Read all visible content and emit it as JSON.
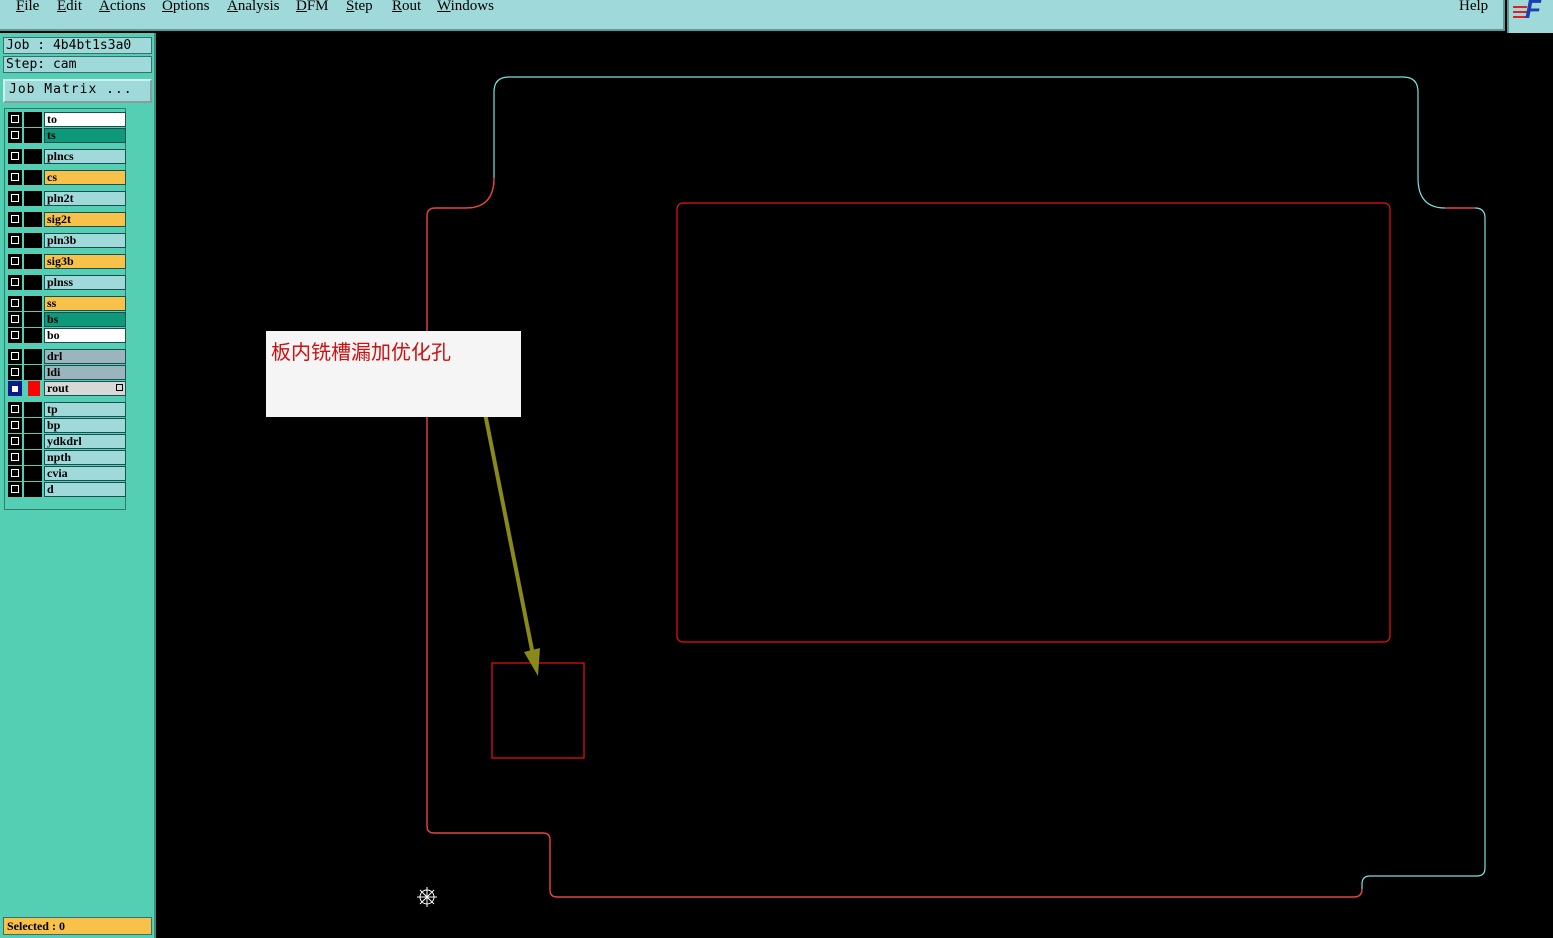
{
  "menu": {
    "items": [
      {
        "label": "File",
        "mnemonic": "F",
        "rest": "ile"
      },
      {
        "label": "Edit",
        "mnemonic": "E",
        "rest": "dit"
      },
      {
        "label": "Actions",
        "mnemonic": "A",
        "rest": "ctions"
      },
      {
        "label": "Options",
        "mnemonic": "O",
        "rest": "ptions"
      },
      {
        "label": "Analysis",
        "mnemonic": "A",
        "rest": "nalysis"
      },
      {
        "label": "DFM",
        "mnemonic": "D",
        "rest": "FM"
      },
      {
        "label": "Step",
        "mnemonic": "S",
        "rest": "tep"
      },
      {
        "label": "Rout",
        "mnemonic": "R",
        "rest": "out"
      },
      {
        "label": "Windows",
        "mnemonic": "W",
        "rest": "indows"
      }
    ],
    "help": {
      "label": "Help",
      "mnemonic": "H",
      "rest": "elp"
    }
  },
  "logo": {
    "text": "F",
    "icon": "frontline-logo-icon",
    "color": "#1a3fb0"
  },
  "job": {
    "label": "Job : 4b4bt1s3a0"
  },
  "step": {
    "label": "Step: cam"
  },
  "job_matrix_button": "Job Matrix ...",
  "layers": [
    {
      "name": "to",
      "color": "#ffffff",
      "active": false
    },
    {
      "name": "ts",
      "color": "#0e9a7a",
      "active": false
    },
    {
      "name": "plncs",
      "color": "#9fd9d9",
      "active": false
    },
    {
      "name": "cs",
      "color": "#f8c24a",
      "active": false
    },
    {
      "name": "pln2t",
      "color": "#9fd9d9",
      "active": false
    },
    {
      "name": "sig2t",
      "color": "#f8c24a",
      "active": false
    },
    {
      "name": "pln3b",
      "color": "#9fd9d9",
      "active": false
    },
    {
      "name": "sig3b",
      "color": "#f8c24a",
      "active": false
    },
    {
      "name": "plnss",
      "color": "#9fd9d9",
      "active": false
    },
    {
      "name": "ss",
      "color": "#f8c24a",
      "active": false
    },
    {
      "name": "bs",
      "color": "#0e9a7a",
      "active": false
    },
    {
      "name": "bo",
      "color": "#ffffff",
      "active": false
    },
    {
      "name": "drl",
      "color": "#9ab5bd",
      "active": false
    },
    {
      "name": "ldi",
      "color": "#9ab5bd",
      "active": false
    },
    {
      "name": "rout",
      "color": "#d8d8d8",
      "active": true,
      "display_color": "#ff0000"
    },
    {
      "name": "tp",
      "color": "#9fd9d9",
      "active": false
    },
    {
      "name": "bp",
      "color": "#9fd9d9",
      "active": false
    },
    {
      "name": "ydkdrl",
      "color": "#9fd9d9",
      "active": false
    },
    {
      "name": "npth",
      "color": "#9fd9d9",
      "active": false
    },
    {
      "name": "cvia",
      "color": "#9fd9d9",
      "active": false
    },
    {
      "name": "d",
      "color": "#9fd9d9",
      "active": false
    }
  ],
  "status": {
    "selected": "Selected : 0"
  },
  "annotation": {
    "text": "板内铣槽漏加优化孔",
    "color": "#cc1111",
    "arrow_color": "#8a8a1a"
  },
  "canvas": {
    "background": "#000000",
    "profile_colors": [
      "#ff3333",
      "#7fe0e0"
    ],
    "rout_color": "#ee1111",
    "origin_icon": "origin-crosshair-icon"
  }
}
